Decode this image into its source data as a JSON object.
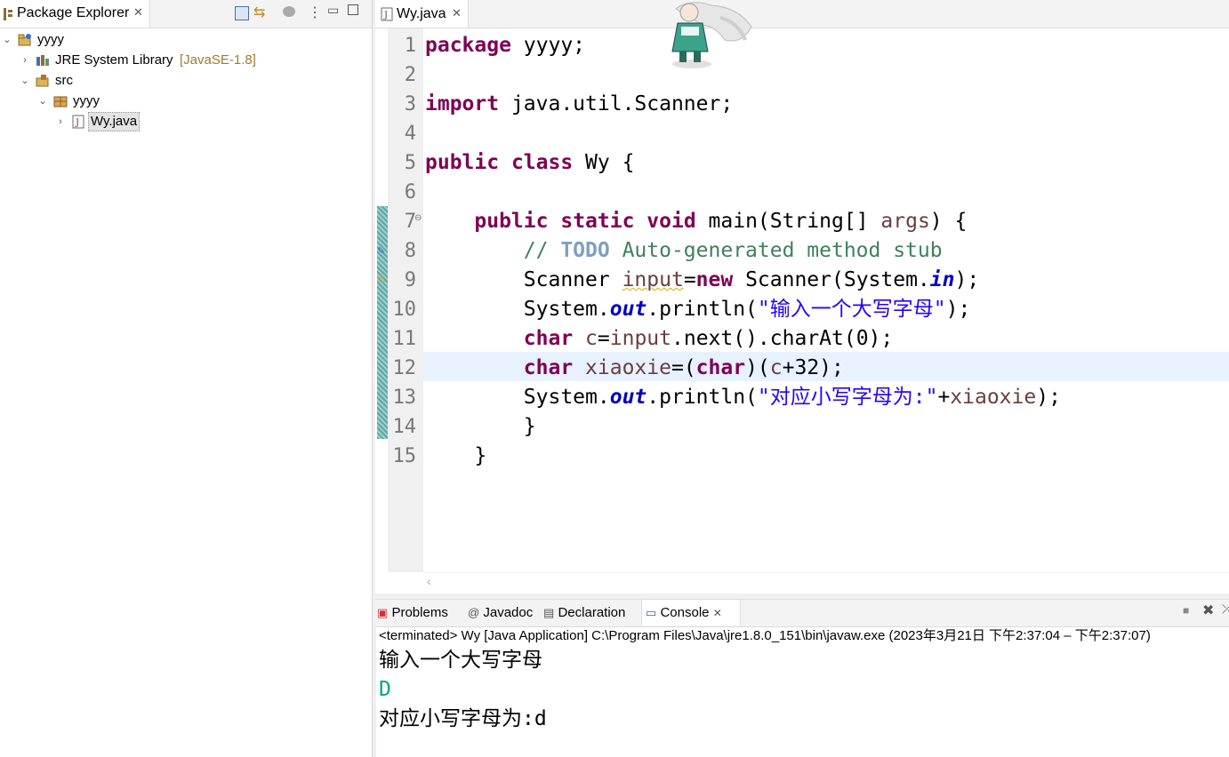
{
  "explorer": {
    "tab_label": "Package Explorer",
    "tree": {
      "project": "yyyy",
      "jre": "JRE System Library",
      "jre_version": "[JavaSE-1.8]",
      "src": "src",
      "package": "yyyy",
      "file": "Wy.java"
    }
  },
  "editor": {
    "tab_label": "Wy.java",
    "line_numbers": [
      "1",
      "2",
      "3",
      "4",
      "5",
      "6",
      "7",
      "8",
      "9",
      "10",
      "11",
      "12",
      "13",
      "14",
      "15"
    ],
    "code": {
      "l1_kw": "package",
      "l1_rest": " yyyy;",
      "l3_kw": "import",
      "l3_rest": " java.util.Scanner;",
      "l5_kw1": "public",
      "l5_kw2": "class",
      "l5_rest": " Wy {",
      "l7_indent": "    ",
      "l7_kw1": "public",
      "l7_kw2": "static",
      "l7_kw3": "void",
      "l7_mid": " main(String[] ",
      "l7_var": "args",
      "l7_end": ") {",
      "l8_indent": "        ",
      "l8_cm1": "// ",
      "l8_todo": "TODO",
      "l8_cm2": " Auto-generated method stub",
      "l9_indent": "        ",
      "l9_a": "Scanner ",
      "l9_var": "input",
      "l9_b": "=",
      "l9_kw": "new",
      "l9_c": " Scanner(System.",
      "l9_fld": "in",
      "l9_d": ");",
      "l10_indent": "        ",
      "l10_a": "System.",
      "l10_fld": "out",
      "l10_b": ".println(",
      "l10_str": "\"输入一个大写字母\"",
      "l10_c": ");",
      "l11_indent": "        ",
      "l11_kw": "char",
      "l11_sp": " ",
      "l11_var1": "c",
      "l11_b": "=",
      "l11_var2": "input",
      "l11_c": ".next().charAt(0);",
      "l12_indent": "        ",
      "l12_kw": "char",
      "l12_sp": " ",
      "l12_var": "xiaoxie",
      "l12_b": "=(",
      "l12_kw2": "char",
      "l12_c": ")(",
      "l12_var2": "c",
      "l12_d": "+32);",
      "l13_indent": "        ",
      "l13_a": "System.",
      "l13_fld": "out",
      "l13_b": ".println(",
      "l13_str": "\"对应小写字母为:\"",
      "l13_c": "+",
      "l13_var": "xiaoxie",
      "l13_d": ");",
      "l14": "        }",
      "l15": "    }"
    }
  },
  "bottom_tabs": {
    "problems": "Problems",
    "javadoc": "Javadoc",
    "declaration": "Declaration",
    "console": "Console"
  },
  "console": {
    "status": "<terminated> Wy [Java Application] C:\\Program Files\\Java\\jre1.8.0_151\\bin\\javaw.exe  (2023年3月21日 下午2:37:04 – 下午2:37:07)",
    "line1": "输入一个大写字母",
    "line2": "D",
    "line3": "对应小写字母为:d"
  }
}
